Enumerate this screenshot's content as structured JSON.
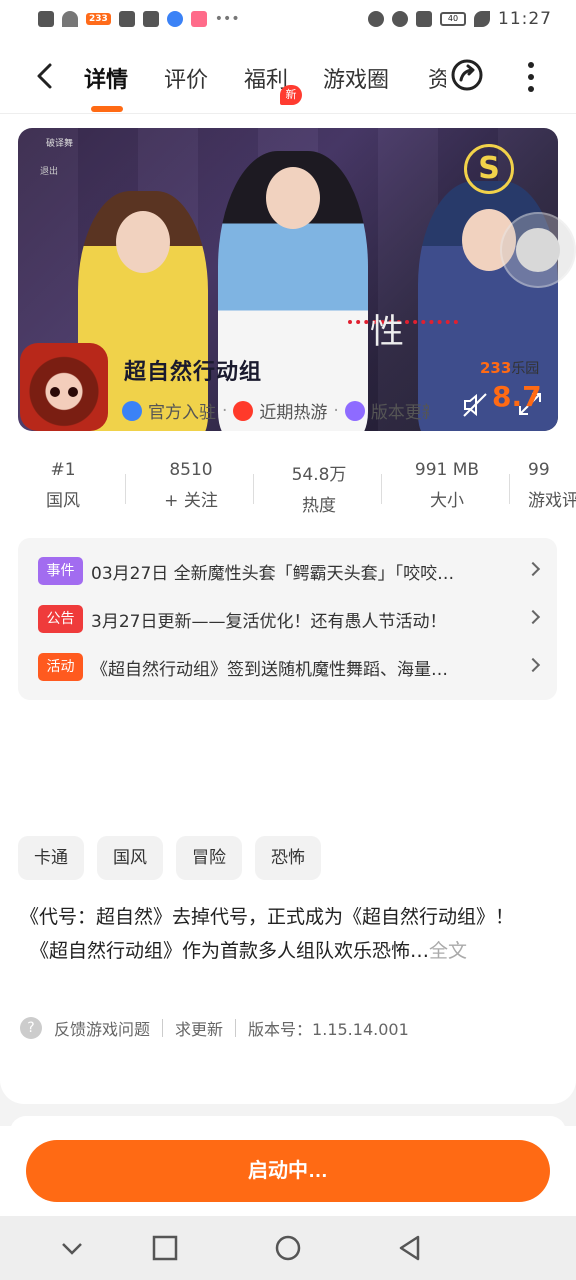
{
  "status_bar": {
    "app_badge": "233",
    "battery": "40",
    "time": "11:27"
  },
  "topbar": {
    "tabs": [
      "详情",
      "评价",
      "福利",
      "游戏圈",
      "资"
    ],
    "new_badge": "新"
  },
  "video": {
    "overlay_title": "破译舞",
    "overlay_sub": "退出",
    "caption": "性",
    "skill_badge": "S"
  },
  "game": {
    "name": "超自然行动组",
    "tags": [
      "官方入驻",
      "近期热游",
      "版本更新"
    ],
    "rating_brand": "233",
    "rating_brand_suffix": "乐园",
    "rating": "8.7"
  },
  "stats": [
    {
      "value": "#1",
      "label": "国风"
    },
    {
      "value": "8510",
      "label": "+ 关注"
    },
    {
      "value": "54.8万",
      "label": "热度"
    },
    {
      "value": "991 MB",
      "label": "大小"
    },
    {
      "value": "99",
      "label": "游戏评"
    }
  ],
  "notices": [
    {
      "badge": "事件",
      "color": "#a26cf0",
      "text": "03月27日 全新魔性头套「鳄霸天头套」「咬咬…"
    },
    {
      "badge": "公告",
      "color": "#ef3b3b",
      "text": "3月27日更新——复活优化！还有愚人节活动！"
    },
    {
      "badge": "活动",
      "color": "#ff5a1f",
      "text": "《超自然行动组》签到送随机魔性舞蹈、海量…"
    }
  ],
  "genres": [
    "卡通",
    "国风",
    "冒险",
    "恐怖"
  ],
  "description": {
    "line1": "《代号：超自然》去掉代号，正式成为《超自然行动组》！",
    "line2": "《超自然行动组》作为首款多人组队欢乐恐怖…",
    "more": "全文"
  },
  "feedback": {
    "report": "反馈游戏问题",
    "request_update": "求更新",
    "version_label": "版本号：",
    "version": "1.15.14.001"
  },
  "launch_button": "启动中…",
  "colors": {
    "accent": "#ff6a14"
  }
}
